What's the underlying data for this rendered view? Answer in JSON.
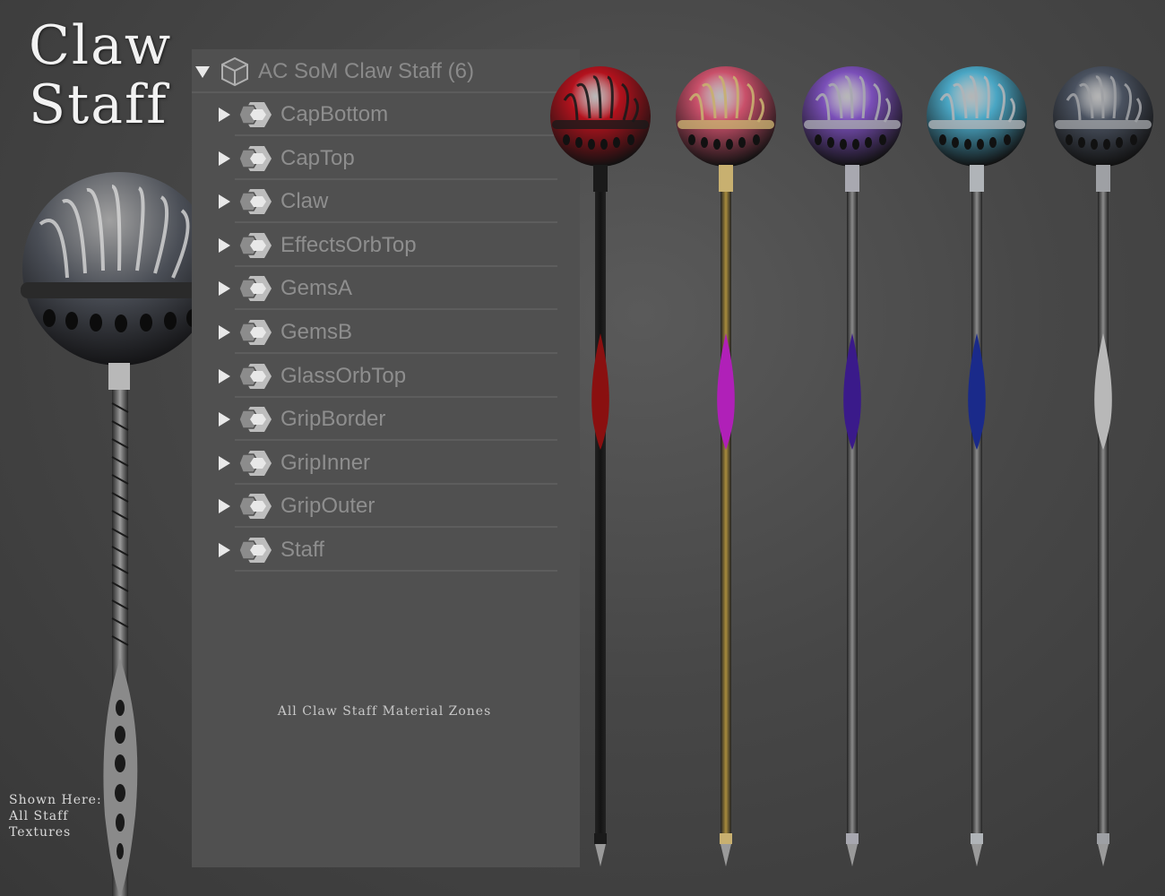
{
  "title": {
    "line1": "Claw",
    "line2": "Staff"
  },
  "footnote": {
    "line1": "Shown Here:",
    "line2": "All Staff",
    "line3": "Textures"
  },
  "scene_panel": {
    "root_label": "AC SoM Claw Staff (6)",
    "items": [
      {
        "label": "CapBottom"
      },
      {
        "label": "CapTop"
      },
      {
        "label": "Claw"
      },
      {
        "label": "EffectsOrbTop"
      },
      {
        "label": "GemsA"
      },
      {
        "label": "GemsB"
      },
      {
        "label": "GlassOrbTop"
      },
      {
        "label": "GripBorder"
      },
      {
        "label": "GripInner"
      },
      {
        "label": "GripOuter"
      },
      {
        "label": "Staff"
      }
    ],
    "caption": "All Claw Staff Material Zones"
  },
  "staff_variants": [
    {
      "orb_color": "#b3121d",
      "claw_color": "#1a1a1a",
      "shaft_color": "#141414",
      "gem_color": "#8a1010"
    },
    {
      "orb_color": "#c9506a",
      "claw_color": "#c8b070",
      "shaft_color": "#a98c3c",
      "gem_color": "#b020b8"
    },
    {
      "orb_color": "#7a4fb8",
      "claw_color": "#a8a8b0",
      "shaft_color": "#8a8a8a",
      "gem_color": "#3a1a8a"
    },
    {
      "orb_color": "#4aa6c4",
      "claw_color": "#b0b4b8",
      "shaft_color": "#8c8c8c",
      "gem_color": "#1a2a8a"
    },
    {
      "orb_color": "#4a5260",
      "claw_color": "#9ea0a4",
      "shaft_color": "#8a8a8a",
      "gem_color": "#b8b8b8"
    }
  ]
}
